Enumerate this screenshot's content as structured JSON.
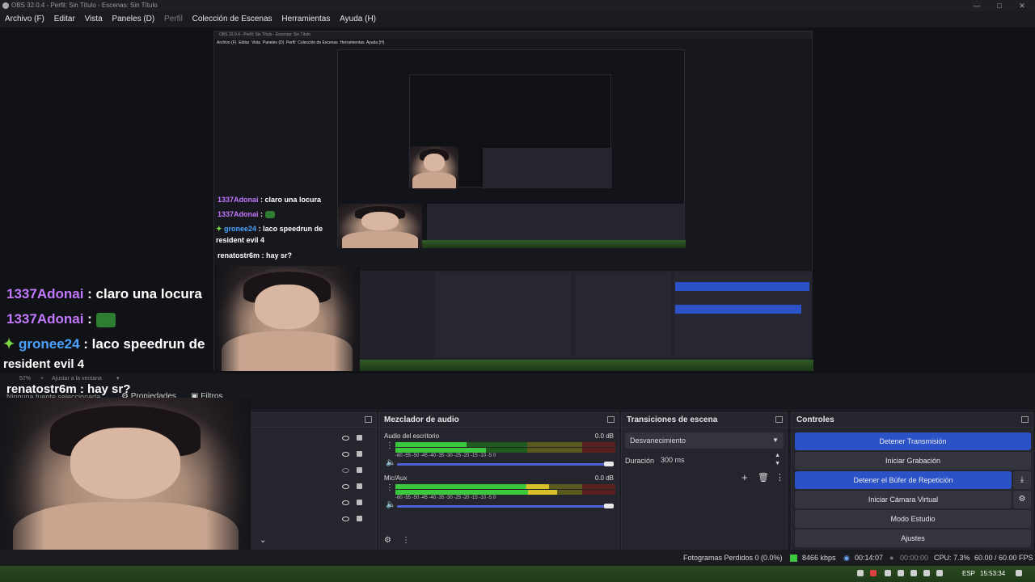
{
  "window": {
    "title": "OBS 32.0.4 - Perfil: Sin Título - Escenas: Sin Título"
  },
  "menu": {
    "items": [
      "Archivo (F)",
      "Editar",
      "Vista",
      "Paneles (D)",
      "Perfil",
      "Colección de Escenas",
      "Herramientas",
      "Ayuda (H)"
    ]
  },
  "chat": {
    "m1_user": "1337Adonai",
    "m1_text": " : claro una locura",
    "m2_user": "1337Adonai",
    "m2_text": " : ",
    "m3_user": "gronee24",
    "m3_text": " : laco speedrun de",
    "m3_cont": "resident evil 4",
    "m4_user": "renatostr6m",
    "m4_text": " : hay sr?"
  },
  "nested": {
    "title": "OBS 32.0.4 - Perfil: Sin Título - Escenas: Sin Título",
    "menu": "Archivo (F)  Editar  Vista  Paneles (D)  Perfil  Colección de Escenas  Herramientas  Ayuda (H)"
  },
  "zoom": {
    "value": "57%",
    "mode": "Ajustar a la ventana"
  },
  "sourcebar": {
    "no_source": "Ninguna fuente seleccionada",
    "properties": "Propiedades",
    "filters": "Filtros"
  },
  "mixer": {
    "title": "Mezclador de audio",
    "ticks": "-60  -55  -50  -45  -40  -35  -30  -25  -20  -15  -10  -5  0",
    "channels": [
      {
        "name": "Audio del escritorio",
        "db": "0.0 dB"
      },
      {
        "name": "Mic/Aux",
        "db": "0.0 dB"
      }
    ]
  },
  "transitions": {
    "title": "Transiciones de escena",
    "selected": "Desvanecimiento",
    "duration_label": "Duración",
    "duration_value": "300 ms"
  },
  "controls": {
    "title": "Controles",
    "stop_stream": "Detener Transmisión",
    "start_rec": "Iniciar Grabación",
    "stop_replay": "Detener el Búfer de Repetición",
    "start_vcam": "Iniciar Cámara Virtual",
    "studio_mode": "Modo Estudio",
    "settings": "Ajustes"
  },
  "status": {
    "dropped": "Fotogramas Perdidos 0 (0.0%)",
    "bitrate": "8466 kbps",
    "stream_time": "00:14:07",
    "rec_time": "00:00:00",
    "cpu": "CPU: 7.3%",
    "fps": "60.00 / 60.00 FPS"
  },
  "taskbar": {
    "lang": "ESP",
    "clock": "15:53:34"
  },
  "colors": {
    "accent": "#2c52c8",
    "chat_user_purple": "#c278ff",
    "chat_user_blue": "#4aa3ff",
    "meter_green": "#3cc83c",
    "meter_yellow": "#d8c02a",
    "meter_red": "#c82a2a"
  }
}
